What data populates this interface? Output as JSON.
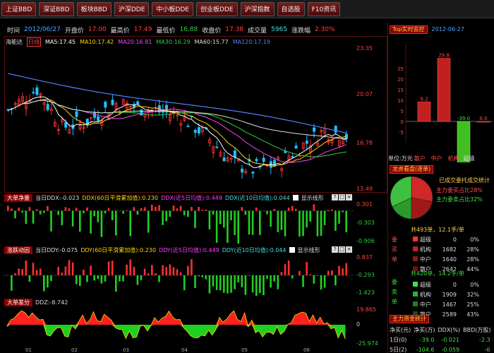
{
  "nav": [
    "上证BBD",
    "深证BBD",
    "板块BBD",
    "沪深DDE",
    "中小板DDE",
    "创业板DDE",
    "沪深指数",
    "自选股",
    "F10资讯"
  ],
  "info": {
    "time_label": "时间",
    "time": "2012/06/27",
    "open_label": "开盘价",
    "open": "17.00",
    "high_label": "最高价",
    "high": "17.49",
    "low_label": "最低价",
    "low": "16.88",
    "close_label": "收盘价",
    "close": "17.38",
    "vol_label": "成交量",
    "vol": "5965",
    "chg_label": "涨跌幅",
    "chg": "2.30%"
  },
  "ma": {
    "name": "海能达",
    "tag": "日线",
    "ma5": "MA5:17.45",
    "ma10": "MA10:17.42",
    "ma20": "MA20:16.81",
    "ma30": "MA30:16.29",
    "ma60": "MA60:15.77",
    "ma120": "MA120:17.19"
  },
  "price_axis": [
    "23.35",
    "20.07",
    "16.78",
    "13.49"
  ],
  "ddx": {
    "tag": "大单净量",
    "cur": "当日DDX:-0.023",
    "avg60": "DDX(60日平滑累加值):0.230",
    "avg5": "DDX(近5日均值):0.449",
    "avg10": "DDX(近10日均值):0.044",
    "show": "显示线形",
    "axis": [
      "0.301",
      "-0.303",
      "-0.906"
    ]
  },
  "ddy": {
    "tag": "涨跌动因",
    "cur": "当日DDY:-0.075",
    "avg60": "DDY(60日平滑累加值):0.230",
    "avg5": "DDY(近5日均值):0.449",
    "avg10": "DDY(近10日均值):0.044",
    "show": "显示线形",
    "axis": [
      "0.837",
      "-0.293",
      "-1.423"
    ]
  },
  "ddz": {
    "tag": "大单差分",
    "cur": "DDZ:-8.742",
    "axis": [
      "19.865",
      "0",
      "-25.974"
    ]
  },
  "xdates": [
    "01",
    "02",
    "03",
    "04",
    "05",
    "06"
  ],
  "right": {
    "top_tag": "Top实时监控",
    "top_date": "2012-06-27",
    "bar_values": [
      "9.2",
      "29.8",
      "-39.0",
      "0.0"
    ],
    "bar_axis": [
      "25",
      "20",
      "15",
      "10",
      "5",
      "0",
      "-5"
    ],
    "bar_cats": [
      "单位:万元",
      "散户",
      "中户",
      "机构",
      "超级"
    ],
    "lhb_tag": "龙虎看盘(逐单)",
    "lhb_title": "已成交委托成交统计",
    "lhb_main_buy": "主力委买占比28%",
    "lhb_main_sell": "主力委卖占比32%",
    "buy_header": "共493单，12.1手/单",
    "buy_side": [
      "委",
      "买",
      "单"
    ],
    "buy_rows": [
      {
        "name": "超级",
        "n": "0",
        "p": "0%"
      },
      {
        "name": "机构",
        "n": "1682",
        "p": "28%"
      },
      {
        "name": "中户",
        "n": "1640",
        "p": "28%"
      },
      {
        "name": "散户",
        "n": "2642",
        "p": "44%"
      }
    ],
    "sell_header": "共420单，14.2手/单",
    "sell_side": [
      "委",
      "卖",
      "单"
    ],
    "sell_rows": [
      {
        "name": "超级",
        "n": "0",
        "p": "0%"
      },
      {
        "name": "机构",
        "n": "1909",
        "p": "32%"
      },
      {
        "name": "中户",
        "n": "1467",
        "p": "25%"
      },
      {
        "name": "散户",
        "n": "2589",
        "p": "43%"
      }
    ],
    "fund_tag": "主力资金统计",
    "fund_headers": [
      "净买(元)",
      "净买(万)",
      "DDX(%)",
      "BBD(万股)"
    ],
    "fund_rows": [
      {
        "p": "1日(0)",
        "a": "-39.0",
        "b": "-0.021",
        "c": "-2.3"
      },
      {
        "p": "5日(2)",
        "a": "-104.6",
        "b": "-0.059",
        "c": "-6"
      }
    ]
  },
  "colors": {
    "up": "#ff3030",
    "down": "#20c020",
    "border": "#5a1010"
  }
}
